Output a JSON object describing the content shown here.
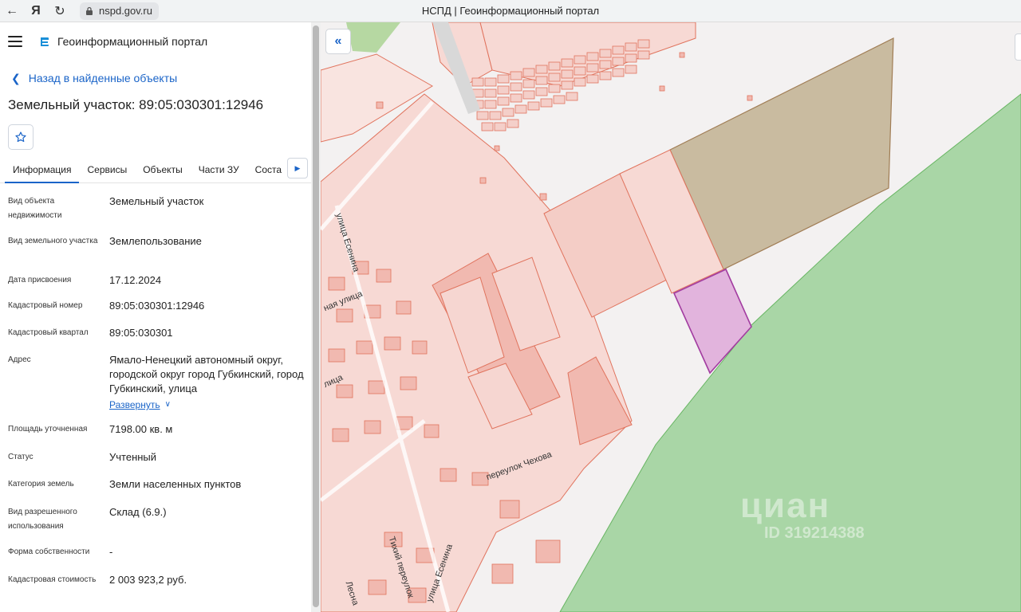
{
  "browser": {
    "url": "nspd.gov.ru",
    "title": "НСПД | Геоинформационный портал"
  },
  "app": {
    "title": "Геоинформационный портал"
  },
  "panel": {
    "back_label": "Назад в найденные объекты",
    "object_title": "Земельный участок: 89:05:030301:12946",
    "tabs": [
      {
        "label": "Информация",
        "active": true
      },
      {
        "label": "Сервисы"
      },
      {
        "label": "Объекты"
      },
      {
        "label": "Части ЗУ"
      },
      {
        "label": "Соста"
      }
    ],
    "rows": [
      {
        "label": "Вид объекта недвижимости",
        "value": "Земельный участок"
      },
      {
        "label": "Вид земельного участка",
        "value": "Землепользование"
      },
      {
        "label": "Дата присвоения",
        "value": "17.12.2024"
      },
      {
        "label": "Кадастровый номер",
        "value": "89:05:030301:12946"
      },
      {
        "label": "Кадастровый квартал",
        "value": "89:05:030301"
      },
      {
        "label": "Адрес",
        "value": "Ямало-Ненецкий автономный округ, городской округ город Губкинский, город Губкинский, улица"
      },
      {
        "label": "Площадь уточненная",
        "value": "7198.00 кв. м"
      },
      {
        "label": "Статус",
        "value": "Учтенный"
      },
      {
        "label": "Категория земель",
        "value": "Земли населенных пунктов"
      },
      {
        "label": "Вид разрешенного использования",
        "value": "Склад (6.9.)"
      },
      {
        "label": "Форма собственности",
        "value": "-"
      },
      {
        "label": "Кадастровая стоимость",
        "value": "2 003 923,2 руб."
      }
    ],
    "expand_label": "Развернуть"
  },
  "map": {
    "streets": {
      "esenina_1": "улица Есенина",
      "naya": "ная улица",
      "litsa": "лица",
      "chekhova": "переулок Чехова",
      "tikhiy": "Тихий переулок",
      "esenina_2": "улица Есенина",
      "lesna": "Лесна"
    },
    "watermark_brand": "циан",
    "watermark_id": "ID 319214388",
    "colors": {
      "parcel_fill": "#f7d9d4",
      "parcel_stroke": "#e0735d",
      "selected_fill": "#e2b4dd",
      "selected_stroke": "#a23ca0",
      "forest": "#a9d6a6",
      "brown_zone": "#c9bba0"
    }
  }
}
